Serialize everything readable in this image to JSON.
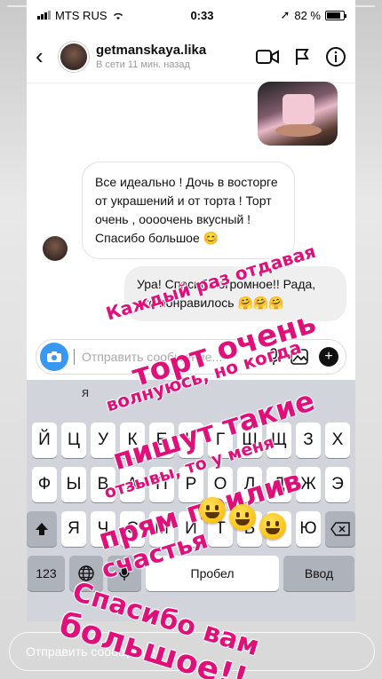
{
  "status_bar": {
    "carrier": "MTS RUS",
    "time": "0:33",
    "battery": "82 %"
  },
  "header": {
    "username": "getmanskaya.lika",
    "last_seen": "В сети 11 мин. назад"
  },
  "messages": {
    "incoming": "Все идеально ! Дочь в восторге от украшений и от торта ! Торт очень , оооочень вкусный ! Спасибо большое 😊",
    "outgoing": "Ура! Спасибо огромное!! Рада, что понравилось 🤗🤗🤗"
  },
  "composer": {
    "placeholder": "Отправить сообщение..."
  },
  "keyboard": {
    "suggestion": "я",
    "row1": [
      "Й",
      "Ц",
      "У",
      "К",
      "Е",
      "Н",
      "Г",
      "Ш",
      "Щ",
      "З",
      "Х"
    ],
    "row2": [
      "Ф",
      "Ы",
      "В",
      "А",
      "П",
      "Р",
      "О",
      "Л",
      "Д",
      "Ж",
      "Э"
    ],
    "row3": [
      "Я",
      "Ч",
      "С",
      "М",
      "И",
      "Т",
      "Ь",
      "Б",
      "Ю"
    ],
    "key_123": "123",
    "space": "Пробел",
    "enter": "Ввод"
  },
  "story_reply": {
    "placeholder": "Отправить сообщение"
  },
  "overlay_lines": [
    "Каждый раз отдавая",
    "торт очень",
    "волнуюсь, но когда",
    "пишут такие",
    "отзывы, то у меня",
    "прям прилив",
    "счастья",
    "Спасибо вам",
    "большое!!"
  ],
  "colors": {
    "overlay_text": "#e0107a",
    "accent": "#3897f0"
  }
}
